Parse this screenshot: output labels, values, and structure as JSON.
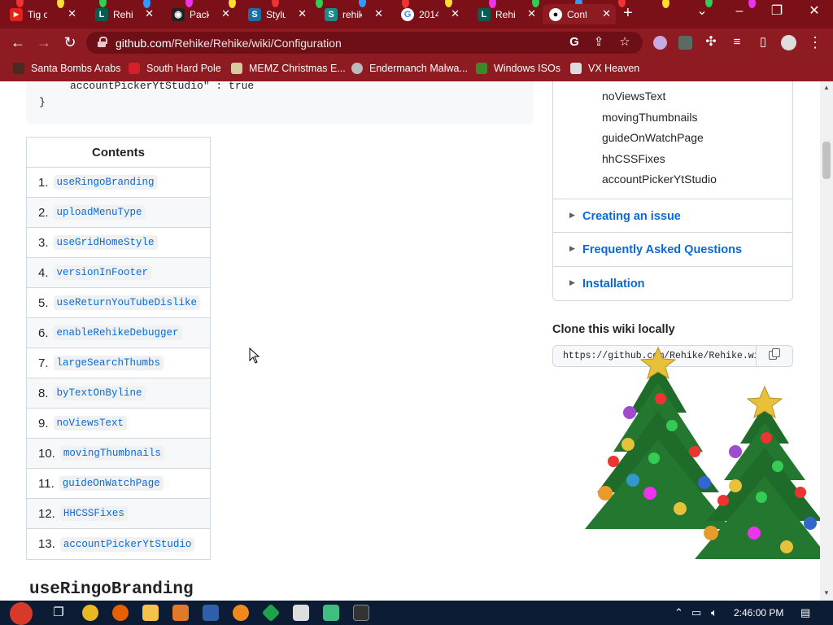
{
  "browser": {
    "tabs": [
      {
        "title": "Tig o",
        "favicon": "youtube-icon",
        "color": "#e62117"
      },
      {
        "title": "Rehik",
        "favicon": "L-icon",
        "color": "#0a5c52"
      },
      {
        "title": "Packa",
        "favicon": "chrome-web-store-icon",
        "color": "#222222"
      },
      {
        "title": "Stylu",
        "favicon": "stylus-icon",
        "color": "#1b6fa6"
      },
      {
        "title": "rehik",
        "favicon": "S-icon",
        "color": "#1a8a8a"
      },
      {
        "title": "2014",
        "favicon": "google-icon",
        "color": "#ffffff"
      },
      {
        "title": "Rehik",
        "favicon": "L-icon",
        "color": "#0a5c52"
      },
      {
        "title": "Confi",
        "favicon": "github-icon",
        "color": "#ffffff"
      }
    ],
    "url_host": "github.com",
    "url_path": "/Rehike/Rehike/wiki/Configuration",
    "bookmarks": [
      {
        "label": "Santa Bombs Arabs",
        "icon": "figure-icon",
        "color": "#4a2a20"
      },
      {
        "label": "South Hard Pole",
        "icon": "maple-leaf-icon",
        "color": "#d4202a"
      },
      {
        "label": "MEMZ Christmas E...",
        "icon": "memz-icon",
        "color": "#d9c9a0"
      },
      {
        "label": "Endermanch Malwa...",
        "icon": "enderman-icon",
        "color": "#bbbbbb"
      },
      {
        "label": "Windows ISOs",
        "icon": "tree-icon",
        "color": "#3a8a2a"
      },
      {
        "label": "VX Heaven",
        "icon": "vx-icon",
        "color": "#dddddd"
      }
    ]
  },
  "code": {
    "line_partial": "accountPickerYtStudio\" : true",
    "closing": "}"
  },
  "toc": {
    "heading": "Contents",
    "items": [
      {
        "num": "1.",
        "label": "useRingoBranding"
      },
      {
        "num": "2.",
        "label": "uploadMenuType"
      },
      {
        "num": "3.",
        "label": "useGridHomeStyle"
      },
      {
        "num": "4.",
        "label": "versionInFooter"
      },
      {
        "num": "5.",
        "label": "useReturnYouTubeDislike"
      },
      {
        "num": "6.",
        "label": "enableRehikeDebugger"
      },
      {
        "num": "7.",
        "label": "largeSearchThumbs"
      },
      {
        "num": "8.",
        "label": "byTextOnByline"
      },
      {
        "num": "9.",
        "label": "noViewsText"
      },
      {
        "num": "10.",
        "label": "movingThumbnails"
      },
      {
        "num": "11.",
        "label": "guideOnWatchPage"
      },
      {
        "num": "12.",
        "label": "HHCSSFixes"
      },
      {
        "num": "13.",
        "label": "accountPickerYtStudio"
      }
    ]
  },
  "section_heading": "useRingoBranding",
  "sidebar": {
    "subitems": [
      "noViewsText",
      "movingThumbnails",
      "guideOnWatchPage",
      "hhCSSFixes",
      "accountPickerYtStudio"
    ],
    "sections": [
      "Creating an issue",
      "Frequently Asked Questions",
      "Installation"
    ],
    "clone_title": "Clone this wiki locally",
    "clone_url": "https://github.com/Rehike/Rehike.wiki.git"
  },
  "taskbar": {
    "time": "2:46:00 PM",
    "apps": [
      {
        "name": "chrome-icon",
        "color": "#e8b923"
      },
      {
        "name": "firefox-icon",
        "color": "#e66000"
      },
      {
        "name": "file-explorer-icon",
        "color": "#f3c34c"
      },
      {
        "name": "app-icon",
        "color": "#e07a2a"
      },
      {
        "name": "powershell-icon",
        "color": "#2f5fa8"
      },
      {
        "name": "search-tool-icon",
        "color": "#f08a1c"
      },
      {
        "name": "xbox-icon",
        "color": "#1ea34a"
      },
      {
        "name": "7zip-icon",
        "color": "#dddddd"
      },
      {
        "name": "notepad-icon",
        "color": "#3fbf7f"
      },
      {
        "name": "terminal-icon",
        "color": "#333333"
      }
    ]
  }
}
